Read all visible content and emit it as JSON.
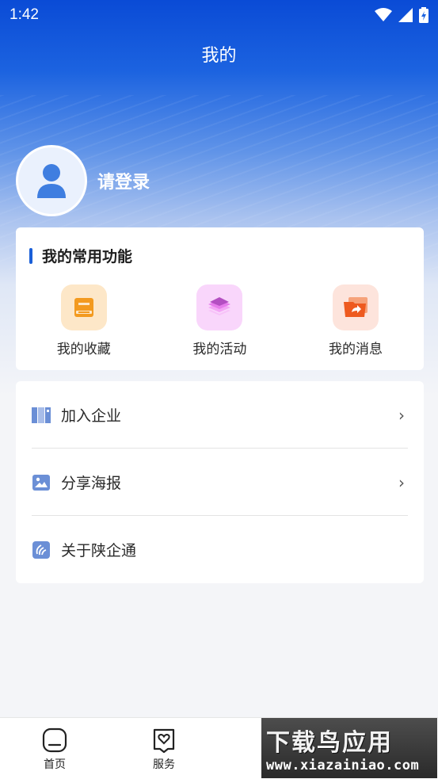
{
  "status_bar": {
    "time": "1:42",
    "icons": [
      "wifi-icon",
      "signal-icon",
      "battery-icon"
    ]
  },
  "header": {
    "title": "我的"
  },
  "profile": {
    "login_text": "请登录"
  },
  "common_functions": {
    "title": "我的常用功能",
    "items": [
      {
        "label": "我的收藏",
        "icon": "bookmark-icon",
        "bg": "#fde7c8"
      },
      {
        "label": "我的活动",
        "icon": "layers-icon",
        "bg": "#f9d6fb"
      },
      {
        "label": "我的消息",
        "icon": "message-folder-icon",
        "bg": "#fde4dc"
      }
    ]
  },
  "menu": {
    "items": [
      {
        "label": "加入企业",
        "icon": "enterprise-icon",
        "arrow": "›"
      },
      {
        "label": "分享海报",
        "icon": "image-icon",
        "arrow": "›"
      },
      {
        "label": "关于陕企通",
        "icon": "about-icon"
      }
    ]
  },
  "tabbar": {
    "items": [
      {
        "label": "首页",
        "icon": "home-icon"
      },
      {
        "label": "服务",
        "icon": "service-icon"
      }
    ]
  },
  "watermark": {
    "main": "下载鸟应用",
    "sub": "www.xiazainiao.com"
  },
  "colors": {
    "accent": "#1a5fd8",
    "hero_top": "#0a4bd6"
  }
}
